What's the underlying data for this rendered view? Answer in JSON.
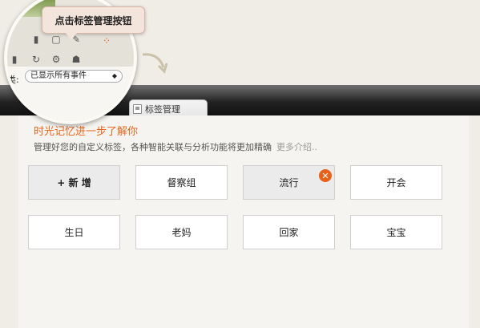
{
  "callout": {
    "text": "点击标签管理按钮"
  },
  "filter": {
    "label": "类:",
    "value": "已显示所有事件"
  },
  "tab": {
    "label": "标签管理"
  },
  "intro": {
    "title": "时光记忆进一步了解你",
    "desc": "管理好您的自定义标签，各种智能关联与分析功能将更加精确",
    "more": "更多介绍.."
  },
  "tags": {
    "add_label": "+ 新 增",
    "items": [
      "督察组",
      "流行",
      "开会",
      "生日",
      "老妈",
      "回家",
      "宝宝"
    ],
    "selected": "流行",
    "remove_icon": "close-icon"
  },
  "colors": {
    "accent": "#e8661c",
    "remove": "#e8611a"
  }
}
